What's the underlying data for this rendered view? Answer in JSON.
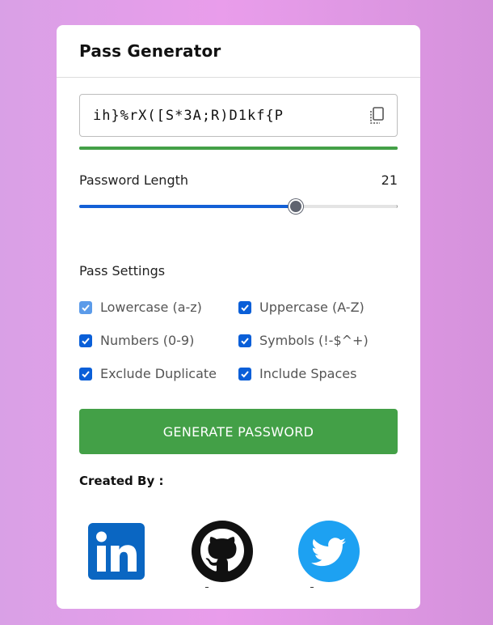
{
  "app": {
    "title": "Pass Generator"
  },
  "password": {
    "value": "ih}%rX([S*3A;R)D1kf{P",
    "strength_color": "#43a047"
  },
  "length": {
    "label": "Password Length",
    "value": "21",
    "slider_fraction": 0.68
  },
  "settings": {
    "label": "Pass Settings",
    "options": [
      {
        "label": "Lowercase (a-z)",
        "checked": true,
        "disabled": true
      },
      {
        "label": "Uppercase (A-Z)",
        "checked": true,
        "disabled": false
      },
      {
        "label": "Numbers (0-9)",
        "checked": true,
        "disabled": false
      },
      {
        "label": "Symbols (!-$^+)",
        "checked": true,
        "disabled": false
      },
      {
        "label": "Exclude Duplicate",
        "checked": true,
        "disabled": false
      },
      {
        "label": "Include Spaces",
        "checked": true,
        "disabled": false
      }
    ]
  },
  "generate": {
    "label": "GENERATE PASSWORD",
    "color": "#43a047"
  },
  "credits": {
    "label": "Created By :",
    "icons": [
      "linkedin-icon",
      "github-icon",
      "twitter-icon"
    ]
  },
  "colors": {
    "accent": "#0a5fd8",
    "linkedin": "#0a66c2",
    "twitter": "#1da1f2"
  }
}
